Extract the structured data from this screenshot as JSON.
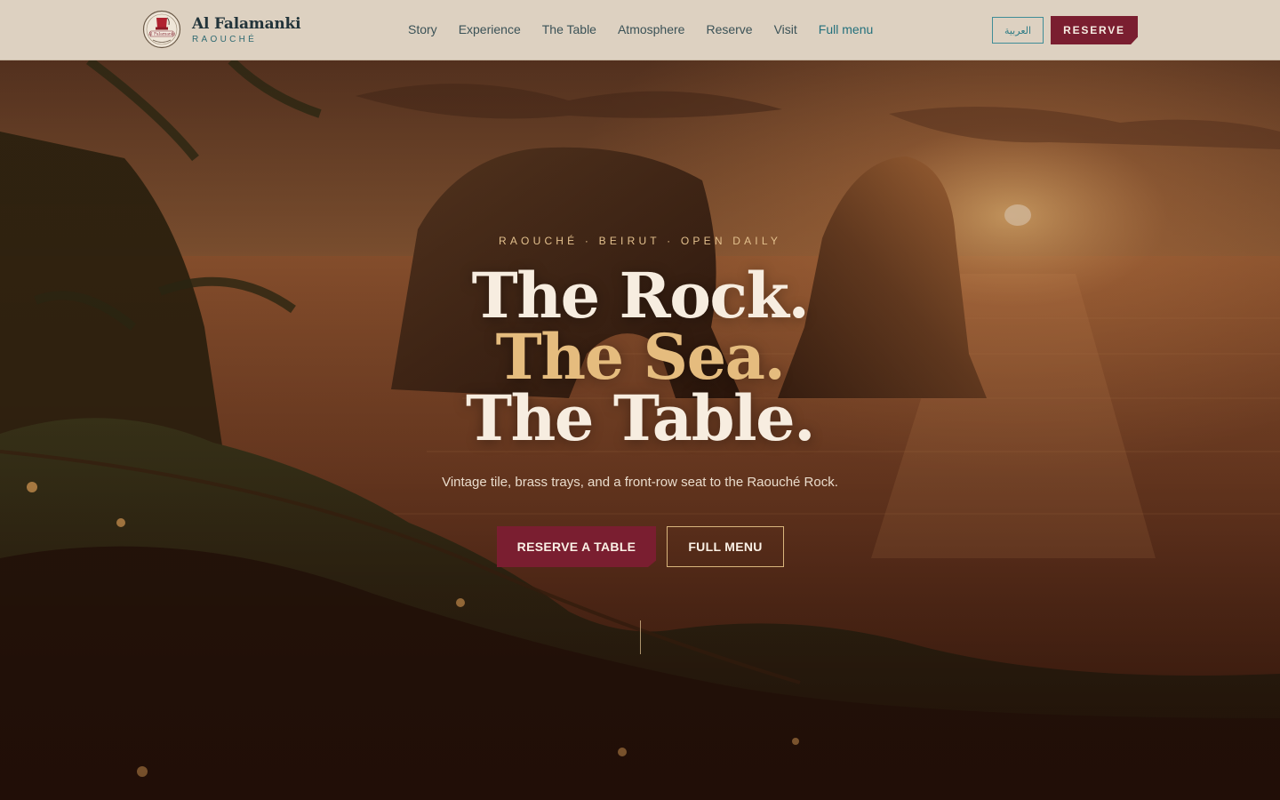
{
  "brand": {
    "name": "Al Falamanki",
    "subtitle": "RAOUCHÉ",
    "logo_text": "Al Falamanki"
  },
  "nav": {
    "items": [
      {
        "label": "Story"
      },
      {
        "label": "Experience"
      },
      {
        "label": "The Table"
      },
      {
        "label": "Atmosphere"
      },
      {
        "label": "Reserve"
      },
      {
        "label": "Visit"
      },
      {
        "label": "Full menu"
      }
    ]
  },
  "header_actions": {
    "language_label": "العربية",
    "reserve_label": "RESERVE"
  },
  "hero": {
    "eyebrow": "RAOUCHÉ · BEIRUT · OPEN DAILY",
    "headline": [
      "The Rock.",
      "The Sea.",
      "The Table."
    ],
    "subtitle": "Vintage tile, brass trays, and a front-row seat to the Raouché Rock.",
    "cta_primary": "RESERVE A TABLE",
    "cta_secondary": "FULL MENU"
  },
  "colors": {
    "header_bg": "#ddd1c1",
    "brand_text": "#22343a",
    "accent_teal": "#2f7c86",
    "accent_burgundy": "#7a1e30",
    "gold": "#e5bc7e",
    "cream": "#f7ede0"
  },
  "icons": {
    "logo": "fez-emblem-icon",
    "scroll": "scroll-indicator-line"
  }
}
